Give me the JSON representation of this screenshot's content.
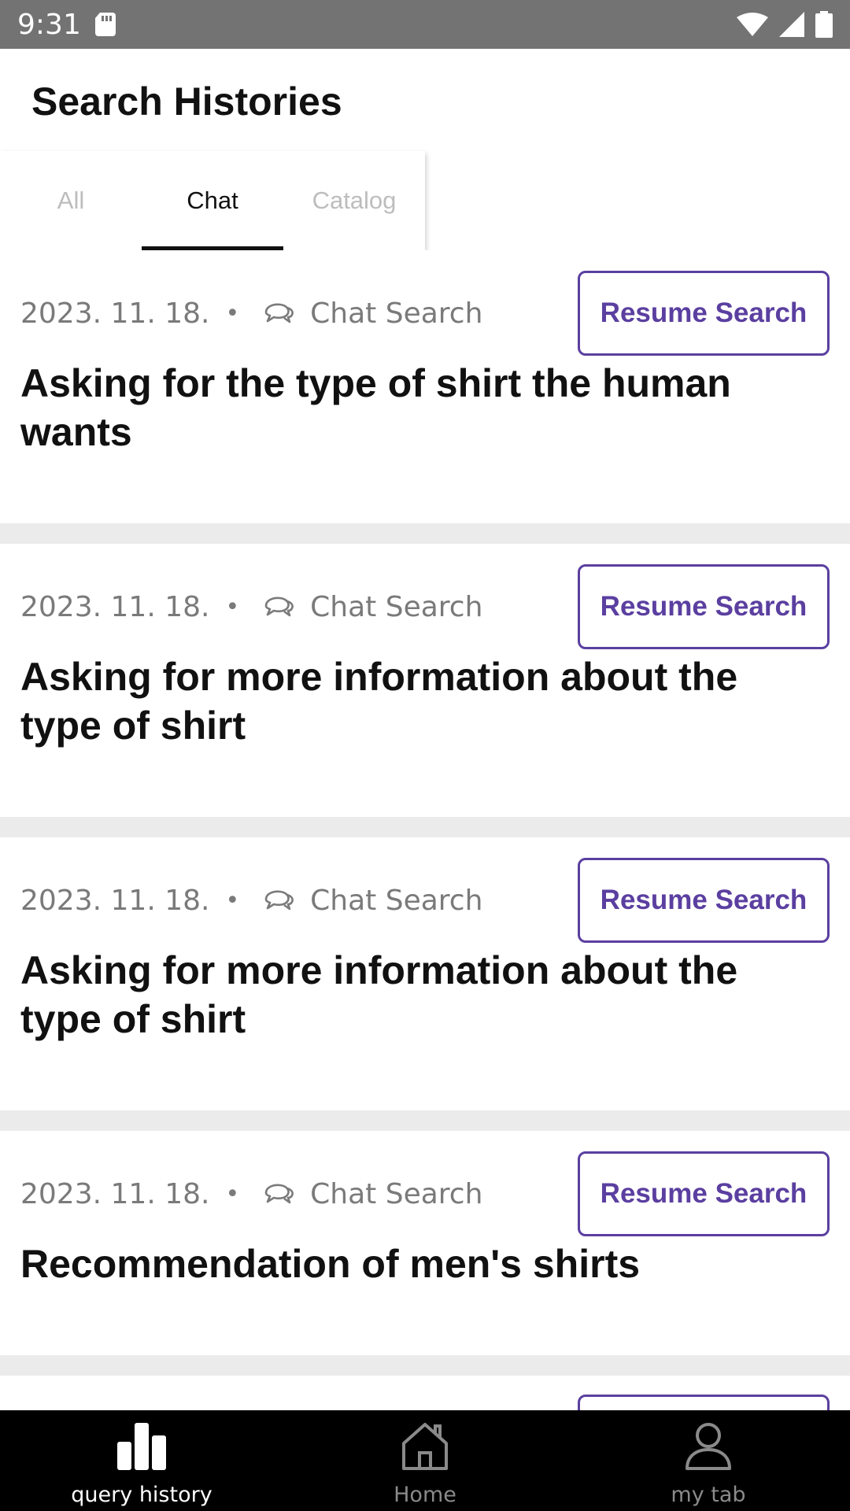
{
  "status_bar": {
    "time": "9:31"
  },
  "header": {
    "title": "Search Histories"
  },
  "tabs": [
    {
      "label": "All",
      "active": false
    },
    {
      "label": "Chat",
      "active": true
    },
    {
      "label": "Catalog",
      "active": false
    }
  ],
  "cards": [
    {
      "date": "2023. 11. 18.",
      "separator": "•",
      "type": "Chat Search",
      "button": "Resume Search",
      "title": "Asking for the type of shirt the human wants"
    },
    {
      "date": "2023. 11. 18.",
      "separator": "•",
      "type": "Chat Search",
      "button": "Resume Search",
      "title": "Asking for more information about the type of shirt"
    },
    {
      "date": "2023. 11. 18.",
      "separator": "•",
      "type": "Chat Search",
      "button": "Resume Search",
      "title": "Asking for more information about the type of shirt"
    },
    {
      "date": "2023. 11. 18.",
      "separator": "•",
      "type": "Chat Search",
      "button": "Resume Search",
      "title": "Recommendation of men's shirts"
    }
  ],
  "bottom_nav": [
    {
      "label": "query history",
      "icon": "bar-chart-icon",
      "active": true
    },
    {
      "label": "Home",
      "icon": "home-icon",
      "active": false
    },
    {
      "label": "my tab",
      "icon": "person-icon",
      "active": false
    }
  ],
  "colors": {
    "accent": "#5b3fa0",
    "status_bar": "#737373",
    "divider": "#ebebeb",
    "nav_bg": "#000000"
  }
}
